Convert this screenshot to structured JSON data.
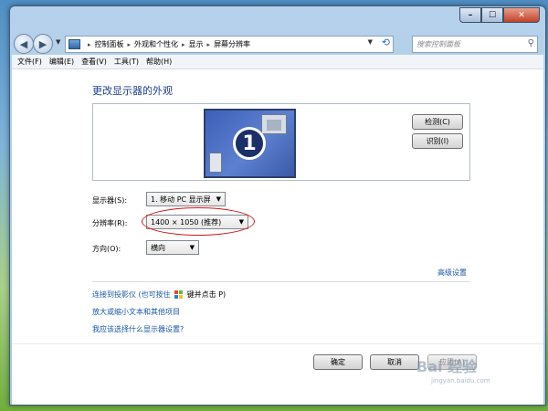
{
  "window": {
    "minimize_symbol": "–",
    "maximize_symbol": "☐",
    "close_symbol": "✕"
  },
  "address": {
    "breadcrumbs": [
      "控制面板",
      "外观和个性化",
      "显示",
      "屏幕分辨率"
    ],
    "search_placeholder": "搜索控制面板"
  },
  "menu": [
    "文件(F)",
    "编辑(E)",
    "查看(V)",
    "工具(T)",
    "帮助(H)"
  ],
  "page": {
    "title": "更改显示器的外观",
    "monitor_number": "1",
    "detect_button": "检测(C)",
    "identify_button": "识别(I)"
  },
  "form": {
    "display_label": "显示器(S):",
    "display_value": "1. 移动 PC 显示屏",
    "resolution_label": "分辨率(R):",
    "resolution_value": "1400 × 1050 (推荐)",
    "orientation_label": "方向(O):",
    "orientation_value": "横向"
  },
  "links": {
    "advanced": "高级设置",
    "projector_prefix": "连接到投影仪 (也可按住",
    "projector_suffix": "键并点击 P)",
    "text_size": "放大或缩小文本和其他项目",
    "which_settings": "我应该选择什么显示器设置?"
  },
  "buttons": {
    "ok": "确定",
    "cancel": "取消",
    "apply": "应用(A)"
  },
  "watermark": {
    "brand": "Bai 经验",
    "url": "jingyan.baidu.com"
  },
  "icons": {
    "back": "back-arrow-icon",
    "forward": "forward-arrow-icon",
    "search": "magnifier-icon",
    "refresh": "refresh-icon",
    "windows_key": "windows-logo-icon"
  }
}
